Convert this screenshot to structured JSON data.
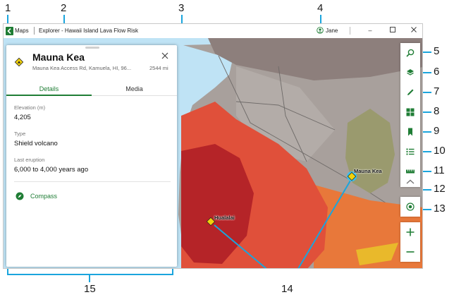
{
  "window": {
    "app_name": "Maps",
    "title": "Explorer - Hawaii Island Lava Flow Risk",
    "user": "Jane",
    "controls": [
      "minimize",
      "maximize",
      "close"
    ]
  },
  "callouts": [
    "1",
    "2",
    "3",
    "4",
    "5",
    "6",
    "7",
    "8",
    "9",
    "10",
    "11",
    "12",
    "13",
    "14",
    "15"
  ],
  "place": {
    "name": "Mauna Kea",
    "address": "Mauna Kea Access Rd, Kamuela, HI, 96...",
    "distance": "2544 mi",
    "tabs": [
      "Details",
      "Media"
    ],
    "active_tab": "Details",
    "fields": [
      {
        "label": "Elevation (m)",
        "value": "4,205"
      },
      {
        "label": "Type",
        "value": "Shield volcano"
      },
      {
        "label": "Last eruption",
        "value": "6,000 to 4,000 years ago"
      }
    ],
    "compass_label": "Compass"
  },
  "map": {
    "labels": [
      "Mauna Kea",
      "Hualalai"
    ],
    "colors": {
      "water": "#bfe3f5",
      "terrain": "#a89e9a",
      "zone_red": "#d83a2c",
      "zone_darkred": "#b01f22",
      "zone_orange": "#e8783a",
      "zone_olive": "#9a9a6e",
      "marker": "#f2d20b"
    }
  },
  "toolbar": {
    "accent": "#1f7d35",
    "icons": [
      "search-icon",
      "layers-icon",
      "pen-icon",
      "basemap-grid-icon",
      "bookmark-icon",
      "legend-list-icon",
      "measure-ruler-icon",
      "collapse-chevron-icon"
    ],
    "locate": "locate-icon",
    "zoom_in": "+",
    "zoom_out": "−"
  },
  "colors": {
    "callout": "#1aa5dd",
    "accent": "#1f7d35"
  }
}
